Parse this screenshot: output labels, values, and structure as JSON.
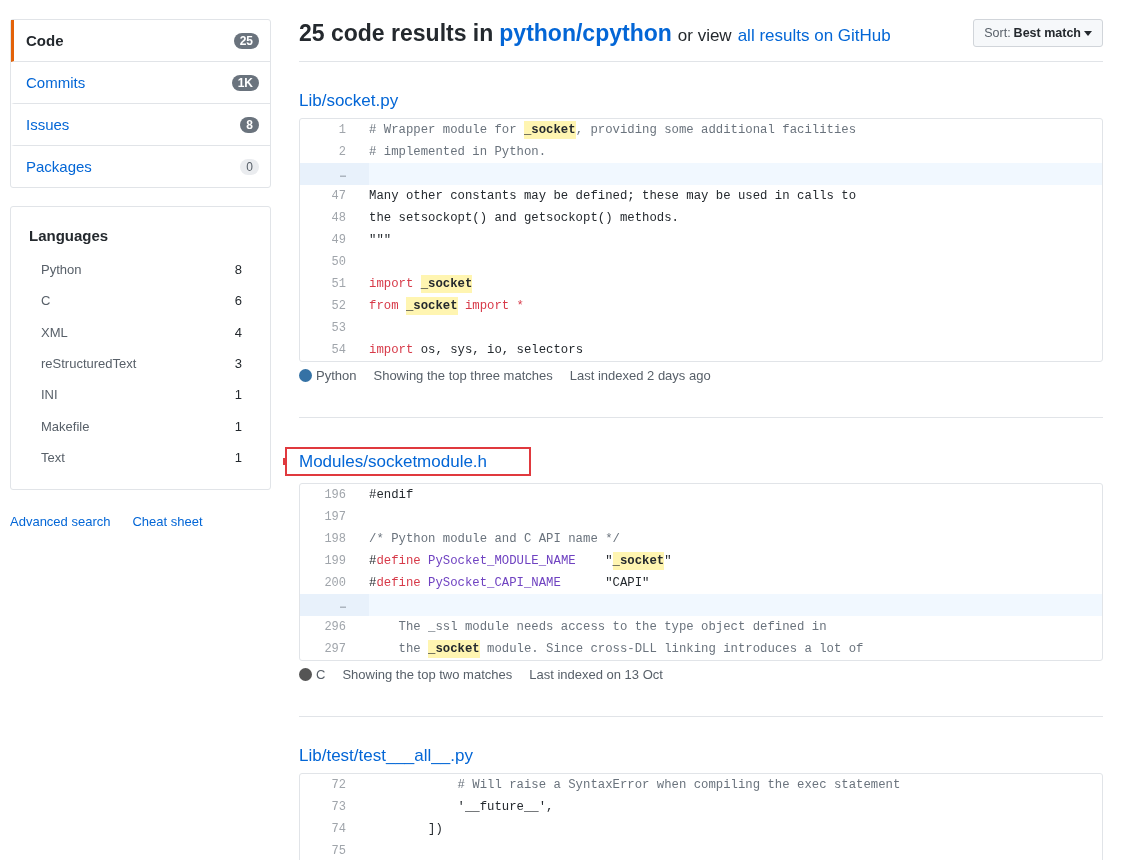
{
  "sidebar": {
    "nav": [
      {
        "label": "Code",
        "count": "25",
        "selected": true,
        "muted": false
      },
      {
        "label": "Commits",
        "count": "1K",
        "selected": false,
        "muted": false
      },
      {
        "label": "Issues",
        "count": "8",
        "selected": false,
        "muted": false
      },
      {
        "label": "Packages",
        "count": "0",
        "selected": false,
        "muted": true
      }
    ],
    "languages": {
      "title": "Languages",
      "items": [
        {
          "name": "Python",
          "count": "8"
        },
        {
          "name": "C",
          "count": "6"
        },
        {
          "name": "XML",
          "count": "4"
        },
        {
          "name": "reStructuredText",
          "count": "3"
        },
        {
          "name": "INI",
          "count": "1"
        },
        {
          "name": "Makefile",
          "count": "1"
        },
        {
          "name": "Text",
          "count": "1"
        }
      ]
    },
    "links": [
      "Advanced search",
      "Cheat sheet"
    ]
  },
  "header": {
    "count_text": "25 code results in",
    "repo": "python/cpython",
    "or_text": "or view",
    "all_link": "all results on GitHub",
    "sort_label": "Sort:",
    "sort_value": "Best match"
  },
  "results": [
    {
      "path": "Lib/socket.py",
      "highlighted": false,
      "lines": [
        {
          "number": "1",
          "tokens": [
            {
              "text": "# Wrapper module for ",
              "kind": "comment"
            },
            {
              "text": "_socket",
              "kind": "match"
            },
            {
              "text": ", providing some additional facilities",
              "kind": "comment"
            }
          ]
        },
        {
          "number": "2",
          "tokens": [
            {
              "text": "# implemented in Python.",
              "kind": "comment"
            }
          ]
        },
        {
          "number": "…",
          "gap": true
        },
        {
          "number": "47",
          "tokens": [
            {
              "text": "Many other constants may be defined; these may be used in calls to",
              "kind": "plain"
            }
          ]
        },
        {
          "number": "48",
          "tokens": [
            {
              "text": "the setsockopt() and getsockopt() methods.",
              "kind": "plain"
            }
          ]
        },
        {
          "number": "49",
          "tokens": [
            {
              "text": "\"\"\"",
              "kind": "plain"
            }
          ]
        },
        {
          "number": "50",
          "gap": false
        },
        {
          "number": "51",
          "tokens": [
            {
              "text": "import ",
              "kind": "keyword"
            },
            {
              "text": "_socket",
              "kind": "match"
            }
          ]
        },
        {
          "number": "52",
          "tokens": [
            {
              "text": "from ",
              "kind": "keyword"
            },
            {
              "text": "_socket",
              "kind": "match"
            },
            {
              "text": " import *",
              "kind": "keyword"
            }
          ]
        },
        {
          "number": "53",
          "gap": false
        },
        {
          "number": "54",
          "tokens": [
            {
              "text": "import",
              "kind": "keyword"
            },
            {
              "text": " os, sys, io, selectors",
              "kind": "plain"
            }
          ]
        }
      ],
      "language": "Python",
      "color": "#3572a5",
      "matches": "Showing the top three matches",
      "indexed": "Last indexed 2 days ago"
    },
    {
      "path": "Modules/socketmodule.h",
      "highlighted": true,
      "lines": [
        {
          "number": "196",
          "tokens": [
            {
              "text": "#endif",
              "kind": "plain"
            }
          ]
        },
        {
          "number": "197",
          "gap": false
        },
        {
          "number": "198",
          "tokens": [
            {
              "text": "/* Python module and C API name */",
              "kind": "comment"
            }
          ]
        },
        {
          "number": "199",
          "tokens": [
            {
              "text": "#",
              "kind": "plain"
            },
            {
              "text": "define",
              "kind": "keyword"
            },
            {
              "text": " PySocket_MODULE_NAME",
              "kind": "macro"
            },
            {
              "text": "    \"",
              "kind": "plain"
            },
            {
              "text": "_socket",
              "kind": "match"
            },
            {
              "text": "\"",
              "kind": "plain"
            }
          ]
        },
        {
          "number": "200",
          "tokens": [
            {
              "text": "#",
              "kind": "plain"
            },
            {
              "text": "define",
              "kind": "keyword"
            },
            {
              "text": " PySocket_CAPI_NAME",
              "kind": "macro"
            },
            {
              "text": "      \"CAPI\"",
              "kind": "plain"
            }
          ]
        },
        {
          "number": "…",
          "gap": true
        },
        {
          "number": "296",
          "tokens": [
            {
              "text": "    The _ssl module needs access to the type object defined in",
              "kind": "comment"
            }
          ]
        },
        {
          "number": "297",
          "tokens": [
            {
              "text": "    the ",
              "kind": "comment"
            },
            {
              "text": "_socket",
              "kind": "match"
            },
            {
              "text": " module. Since cross-DLL linking introduces a lot of",
              "kind": "comment"
            }
          ]
        }
      ],
      "language": "C",
      "color": "#555555",
      "matches": "Showing the top two matches",
      "indexed": "Last indexed on 13 Oct"
    },
    {
      "path": "Lib/test/test___all__.py",
      "highlighted": false,
      "lines": [
        {
          "number": "72",
          "tokens": [
            {
              "text": "            # Will raise a SyntaxError when compiling the exec statement",
              "kind": "comment"
            }
          ]
        },
        {
          "number": "73",
          "tokens": [
            {
              "text": "            '__future__',",
              "kind": "plain"
            }
          ]
        },
        {
          "number": "74",
          "tokens": [
            {
              "text": "        ])",
              "kind": "plain"
            }
          ]
        },
        {
          "number": "75",
          "gap": false
        }
      ]
    }
  ]
}
